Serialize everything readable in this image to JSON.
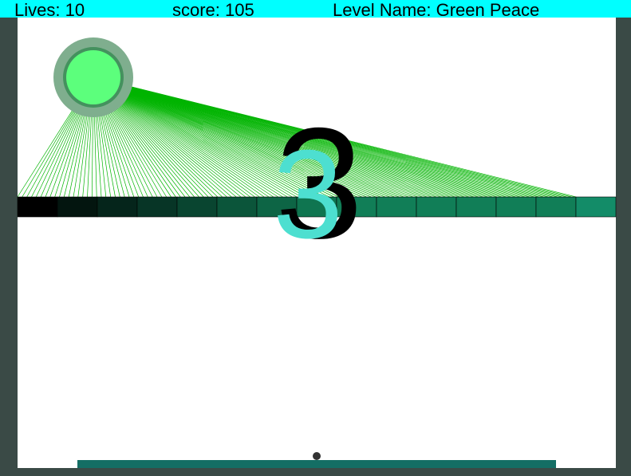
{
  "hud": {
    "lives_label": "Lives: 10",
    "score_label": "score: 105",
    "level_label": "Level Name: Green Peace"
  },
  "countdown": {
    "value": "3"
  },
  "colors": {
    "hud_background": "#00ffff",
    "wall": "#3a4a46",
    "sun_outer": "#7fae8e",
    "sun_ring": "#44915e",
    "sun_core": "#5cff7c",
    "sun_rays": "#00b400",
    "paddle": "#146e64",
    "ball": "#333333",
    "countdown_front": "#4ddfd0",
    "countdown_back": "#000000",
    "block_border": "#000000",
    "blocks": [
      "#000000",
      "#03150f",
      "#05251b",
      "#073526",
      "#094530",
      "#0b553a",
      "#0d6545",
      "#0f7550",
      "#117e57",
      "#117e57",
      "#117e57",
      "#117e57",
      "#117e57",
      "#117e57",
      "#138c68"
    ]
  }
}
